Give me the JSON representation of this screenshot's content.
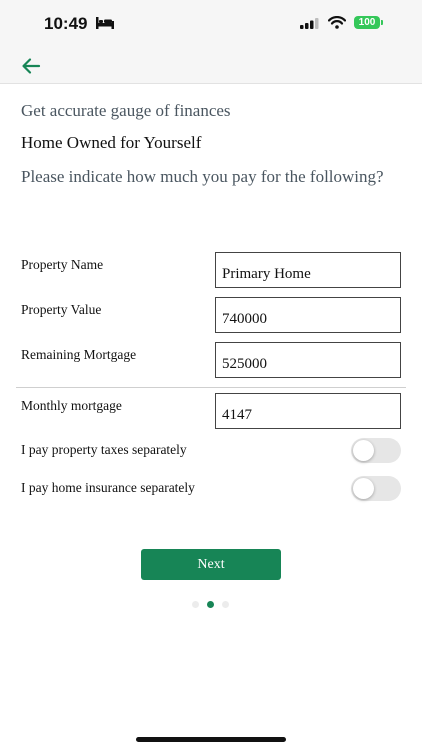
{
  "status_bar": {
    "time": "10:49",
    "battery": "100",
    "bed_icon": "bed-icon",
    "signal_icon": "cellular-signal-icon",
    "wifi_icon": "wifi-icon"
  },
  "nav": {
    "back_icon": "arrow-left-icon"
  },
  "page": {
    "subtitle": "Get accurate gauge of finances",
    "section_title": "Home Owned for Yourself",
    "instructions": "Please indicate how much you pay for the following?"
  },
  "form": {
    "property_name": {
      "label": "Property Name",
      "value": "Primary Home"
    },
    "property_value": {
      "label": "Property Value",
      "value": "740000"
    },
    "remaining_mortgage": {
      "label": "Remaining Mortgage",
      "value": "525000"
    },
    "monthly_mortgage": {
      "label": "Monthly mortgage",
      "value": "4147"
    }
  },
  "toggles": {
    "property_taxes": {
      "label": "I pay property taxes separately",
      "on": false
    },
    "home_insurance": {
      "label": "I pay home insurance separately",
      "on": false
    }
  },
  "actions": {
    "next_label": "Next"
  },
  "pager": {
    "total": 3,
    "current": 2
  },
  "colors": {
    "accent": "#178556",
    "toggle_off": "#e6e6e6",
    "battery": "#34c759"
  }
}
